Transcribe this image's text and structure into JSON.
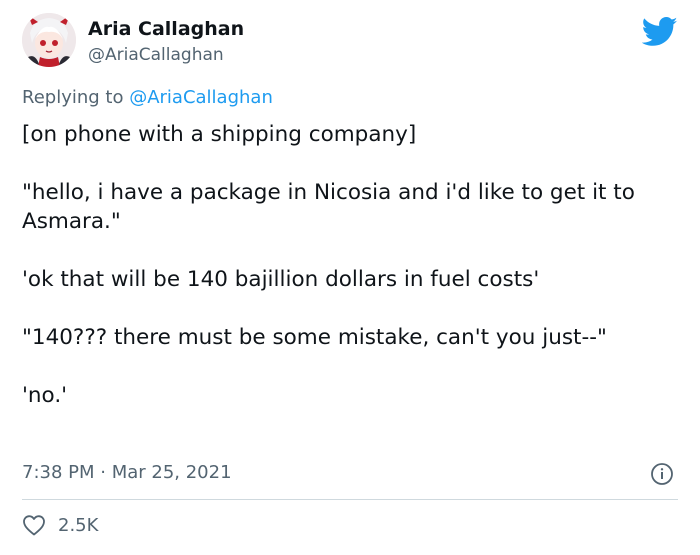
{
  "author": {
    "name": "Aria Callaghan",
    "handle": "@AriaCallaghan",
    "avatar_icon": "anime-character-avatar"
  },
  "reply": {
    "prefix": "Replying to ",
    "mention": "@AriaCallaghan"
  },
  "tweet": {
    "paragraphs": [
      "[on phone with a shipping company]",
      "\"hello, i have a package in Nicosia and i'd like to get it to Asmara.\"",
      "'ok that will be 140 bajillion dollars in fuel costs'",
      "\"140??? there must be some mistake, can't you just--\"",
      "'no.'"
    ]
  },
  "meta": {
    "time": "7:38 PM",
    "separator": " · ",
    "date": "Mar 25, 2021"
  },
  "engagement": {
    "likes": "2.5K"
  },
  "colors": {
    "text": "#0f1419",
    "secondary": "#536471",
    "accent": "#1d9bf0",
    "divider": "#cfd9de"
  },
  "icons": {
    "brand": "twitter-bird-icon",
    "info": "info-icon",
    "like": "heart-icon"
  }
}
